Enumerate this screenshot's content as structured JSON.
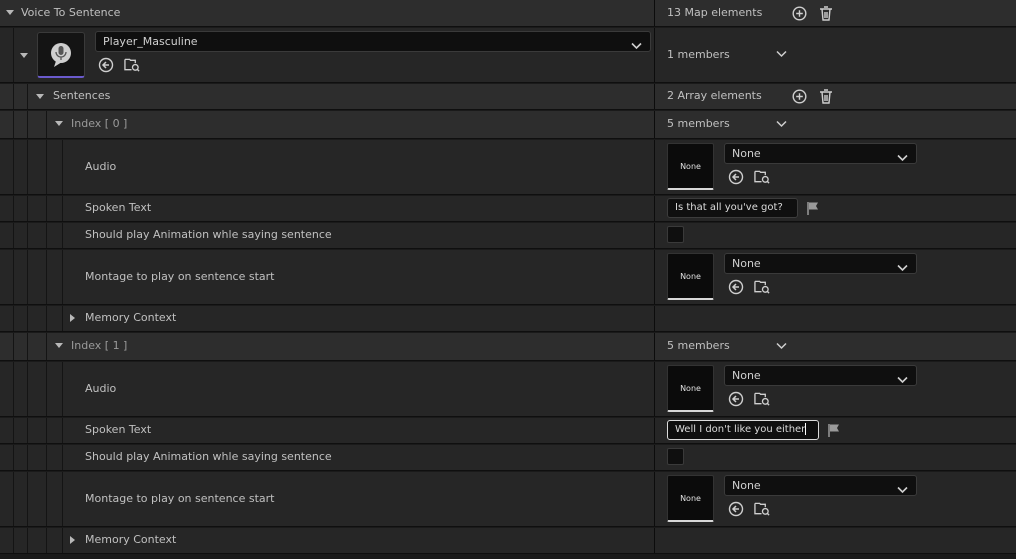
{
  "root": {
    "label": "Voice To Sentence",
    "count": "13 Map elements"
  },
  "entry": {
    "key_value": "Player_Masculine",
    "members": "1 members"
  },
  "sentences": {
    "label": "Sentences",
    "count": "2 Array elements"
  },
  "indices": [
    {
      "label": "Index [ 0 ]",
      "members": "5 members",
      "audio_label": "Audio",
      "audio_thumb": "None",
      "audio_value": "None",
      "spoken_label": "Spoken Text",
      "spoken_value": "Is that all you've got?",
      "anim_label": "Should play Animation whle saying sentence",
      "montage_label": "Montage to play on sentence start",
      "montage_thumb": "None",
      "montage_value": "None",
      "memory_label": "Memory Context"
    },
    {
      "label": "Index [ 1 ]",
      "members": "5 members",
      "audio_label": "Audio",
      "audio_thumb": "None",
      "audio_value": "None",
      "spoken_label": "Spoken Text",
      "spoken_value": "Well I don't like you either",
      "anim_label": "Should play Animation whle saying sentence",
      "montage_label": "Montage to play on sentence start",
      "montage_thumb": "None",
      "montage_value": "None",
      "memory_label": "Memory Context"
    }
  ],
  "icons": {
    "add": "plus-circle-icon",
    "delete": "trash-icon",
    "expand": "chevron-down-icon",
    "use_selected": "arrow-left-circle-icon",
    "browse": "folder-search-icon",
    "localize": "flag-icon",
    "audio_asset": "microphone-icon"
  },
  "colors": {
    "background": "#1a1a1a",
    "row_header": "#2d2d2d",
    "row_body": "#262626",
    "text": "#c0c0c0",
    "accent": "#6a5acd"
  }
}
